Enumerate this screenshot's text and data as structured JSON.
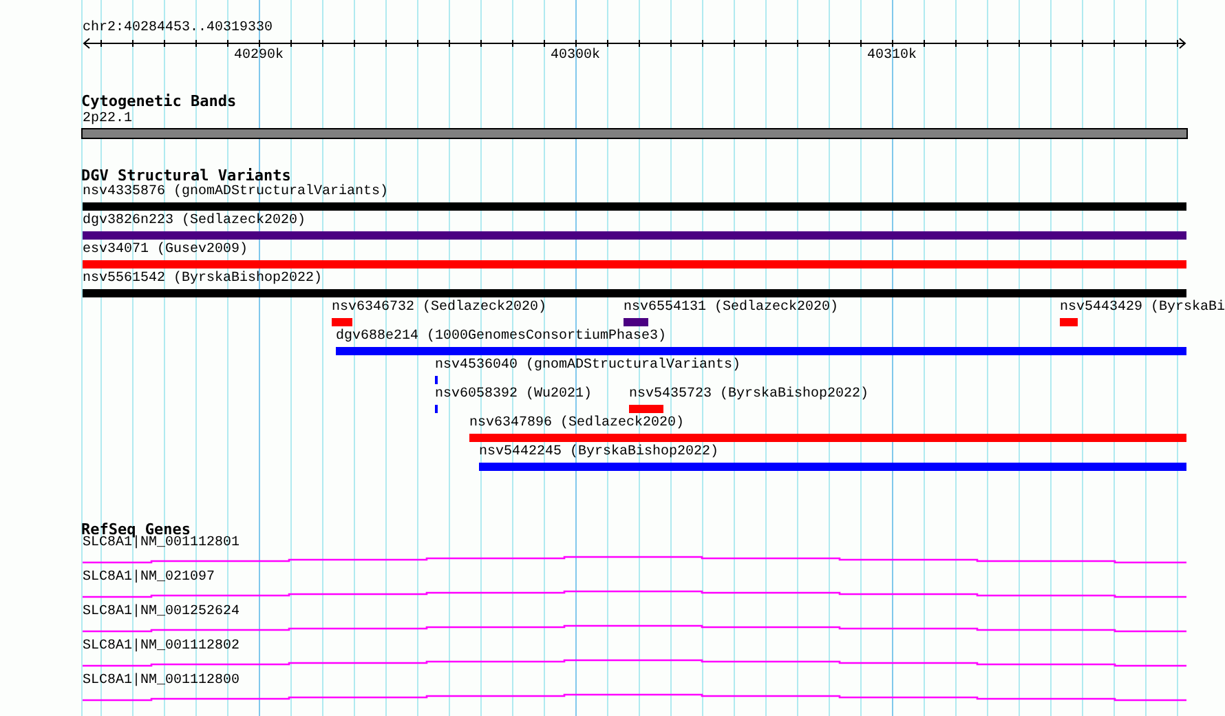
{
  "ruler": {
    "location": "chr2:40284453..40319330",
    "ticks": [
      "40290k",
      "40300k",
      "40310k"
    ]
  },
  "tracks": [
    {
      "kind": "bands",
      "title": "Cytogenetic Bands",
      "features": [
        {
          "label": "2p22.1",
          "color": "#808080"
        }
      ]
    },
    {
      "kind": "variants",
      "title": "DGV Structural Variants",
      "features": [
        {
          "label": "nsv4335876 (gnomADStructuralVariants)",
          "color": "#000000"
        },
        {
          "label": "dgv3826n223 (Sedlazeck2020)",
          "color": "#4b0082"
        },
        {
          "label": "esv34071 (Gusev2009)",
          "color": "#ff0000"
        },
        {
          "label": "nsv5561542 (ByrskaBishop2022)",
          "color": "#000000"
        },
        {
          "label": "nsv6346732 (Sedlazeck2020)",
          "color": "#ff0000"
        },
        {
          "label": "nsv6554131 (Sedlazeck2020)",
          "color": "#4b0082"
        },
        {
          "label": "nsv5443429 (ByrskaBi",
          "color": "#ff0000"
        },
        {
          "label": "dgv688e214 (1000GenomesConsortiumPhase3)",
          "color": "#0000ff"
        },
        {
          "label": "nsv4536040 (gnomADStructuralVariants)",
          "color": "#0000ff"
        },
        {
          "label": "nsv6058392 (Wu2021)",
          "color": "#0000ff"
        },
        {
          "label": "nsv5435723 (ByrskaBishop2022)",
          "color": "#ff0000"
        },
        {
          "label": "nsv6347896 (Sedlazeck2020)",
          "color": "#ff0000"
        },
        {
          "label": "nsv5442245 (ByrskaBishop2022)",
          "color": "#0000ff"
        }
      ]
    },
    {
      "kind": "genes",
      "title": "RefSeq Genes",
      "features": [
        {
          "label": "SLC8A1|NM_001112801"
        },
        {
          "label": "SLC8A1|NM_021097"
        },
        {
          "label": "SLC8A1|NM_001252624"
        },
        {
          "label": "SLC8A1|NM_001112802"
        },
        {
          "label": "SLC8A1|NM_001112800"
        }
      ]
    }
  ]
}
